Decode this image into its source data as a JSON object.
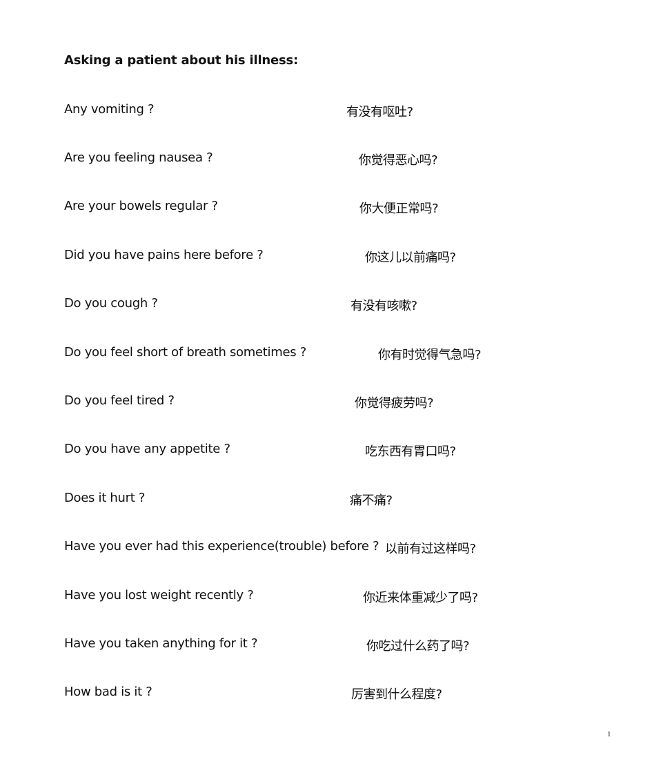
{
  "document": {
    "title": "Asking a patient about his illness:",
    "rows": [
      {
        "en": "Any vomiting ?",
        "zh": "有没有呕吐?"
      },
      {
        "en": "Are you feeling nausea ?",
        "zh": "你觉得恶心吗?"
      },
      {
        "en": "Are your bowels regular ?",
        "zh": "你大便正常吗?"
      },
      {
        "en": "Did you have pains here before ?",
        "zh": "你这儿以前痛吗?"
      },
      {
        "en": "Do you cough ?",
        "zh": "有没有咳嗽?"
      },
      {
        "en": "Do you feel short of breath sometimes ?",
        "zh": "你有时觉得气急吗?"
      },
      {
        "en": "Do you feel tired ?",
        "zh": "你觉得疲劳吗?"
      },
      {
        "en": "Do you have any appetite ?",
        "zh": "吃东西有胃口吗?"
      },
      {
        "en": "Does it hurt ?",
        "zh": "痛不痛?"
      },
      {
        "en": "Have you ever had this experience(trouble) before ?",
        "zh": "以前有过这样吗?"
      },
      {
        "en": "Have you lost weight recently ?",
        "zh": "你近来体重减少了吗?"
      },
      {
        "en": "Have you taken anything for it ?",
        "zh": "你吃过什么药了吗?"
      },
      {
        "en": "How bad is it ?",
        "zh": "厉害到什么程度?"
      }
    ],
    "page_number": "1"
  }
}
